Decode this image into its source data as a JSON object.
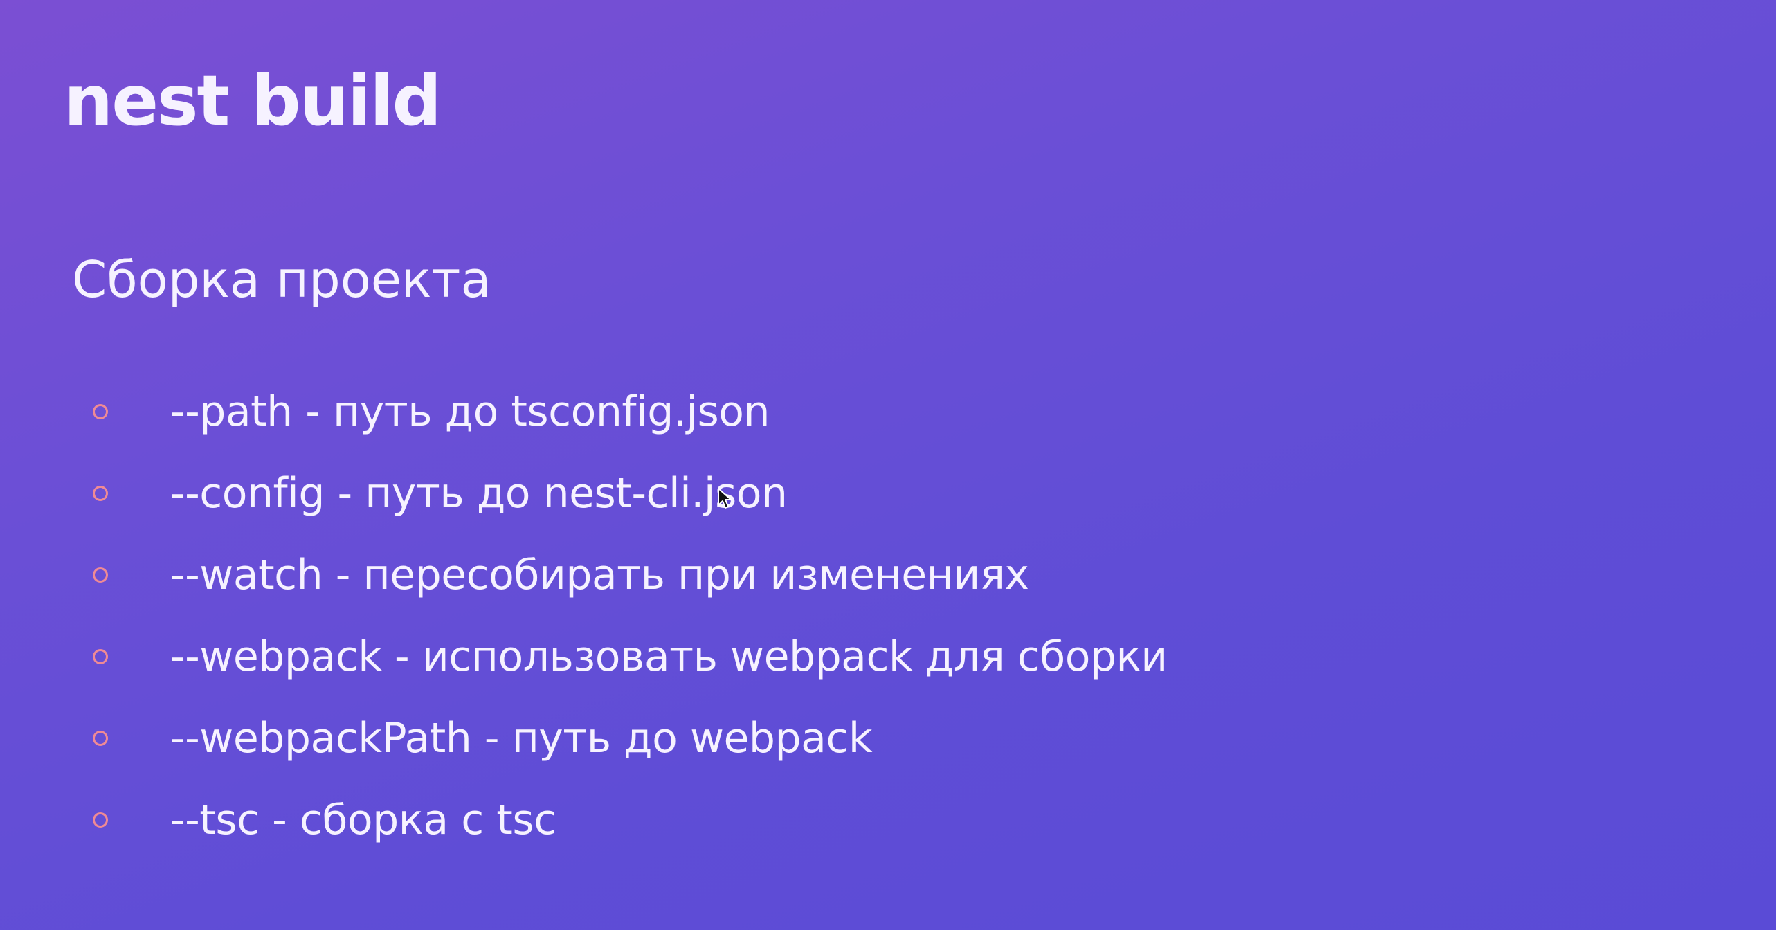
{
  "slide": {
    "title": "nest build",
    "subtitle": "Сборка проекта",
    "items": [
      {
        "text": "--path - путь до tsconfig.json"
      },
      {
        "text": "--config - путь до nest-cli.json"
      },
      {
        "text": "--watch - пересобирать при изменениях"
      },
      {
        "text": "--webpack - использовать webpack для сборки"
      },
      {
        "text": "--webpackPath - путь до webpack"
      },
      {
        "text": "--tsc - сборка с tsc"
      }
    ]
  },
  "colors": {
    "background_start": "#7b4fd3",
    "background_end": "#5a4bd6",
    "text": "#f6f2ff",
    "bullet": "#ef8a95"
  },
  "icons": {
    "bullet": "hollow-circle-bullet-icon",
    "cursor": "mouse-pointer-icon"
  }
}
